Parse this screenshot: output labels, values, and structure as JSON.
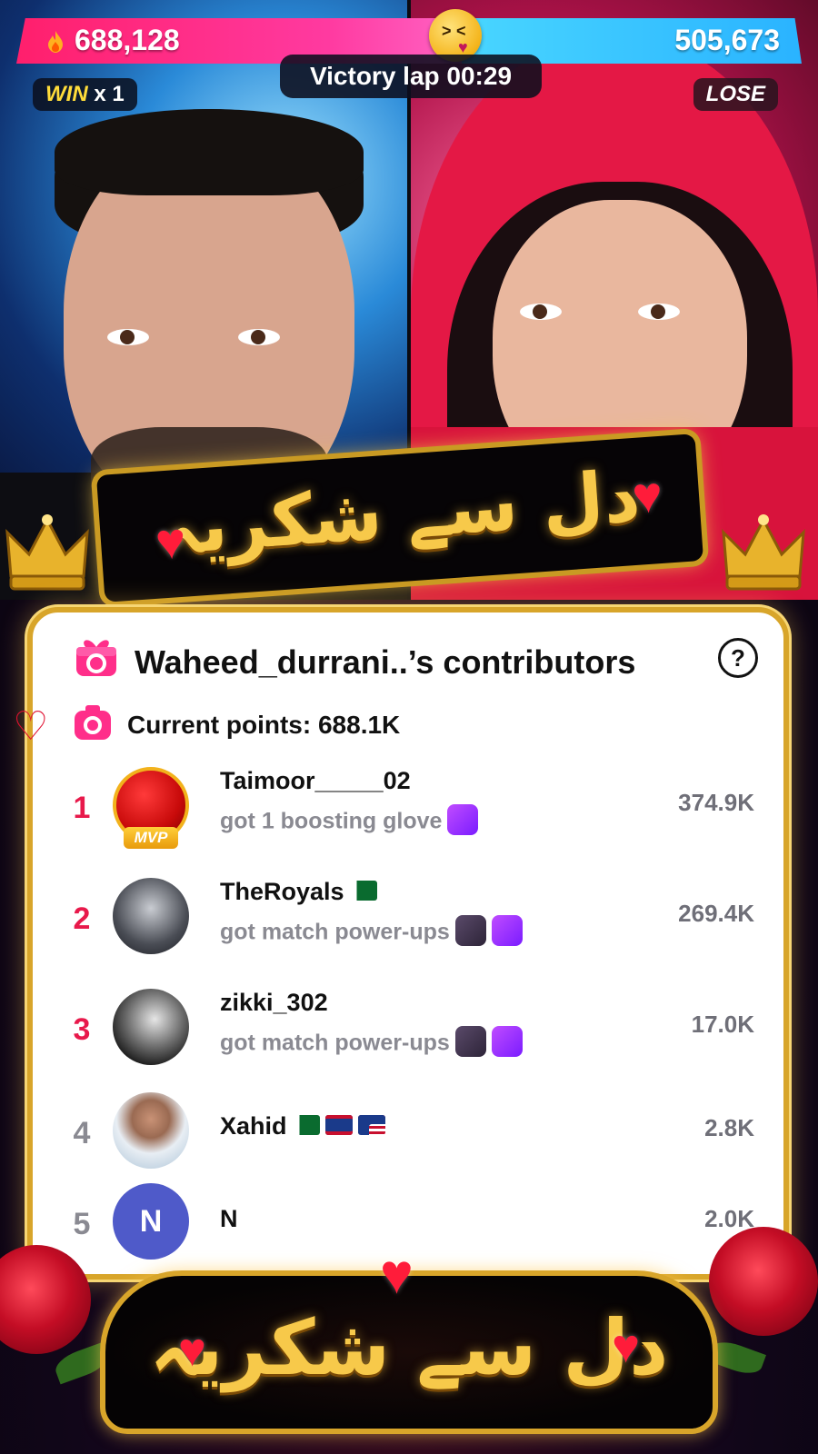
{
  "battle": {
    "left_score": "688,128",
    "right_score": "505,673",
    "timer_label": "Victory lap 00:29",
    "win_label": "WIN",
    "win_count": "x 1",
    "lose_label": "LOSE",
    "colors": {
      "left": "#ff1f6c",
      "right": "#2ab3ff"
    }
  },
  "banner": {
    "urdu_text": "دل سے شکریہ"
  },
  "contributors": {
    "title": "Waheed_durrani..’s contributors",
    "current_points": "Current points: 688.1K",
    "items": [
      {
        "rank": "1",
        "name": "Taimoor_____02",
        "subtitle": "got 1 boosting glove",
        "points": "374.9K",
        "badge": "MVP",
        "rank_color": "#e8194b"
      },
      {
        "rank": "2",
        "name": "TheRoyals",
        "subtitle": "got match power-ups",
        "points": "269.4K",
        "rank_color": "#e8194b"
      },
      {
        "rank": "3",
        "name": "zikki_302",
        "subtitle": "got match power-ups",
        "points": "17.0K",
        "rank_color": "#e8194b"
      },
      {
        "rank": "4",
        "name": "Xahid",
        "subtitle": "",
        "points": "2.8K",
        "rank_color": "#8a8a92"
      },
      {
        "rank": "5",
        "name": "N",
        "subtitle": "",
        "points": "2.0K",
        "avatar_letter": "N",
        "rank_color": "#8a8a92"
      }
    ]
  }
}
